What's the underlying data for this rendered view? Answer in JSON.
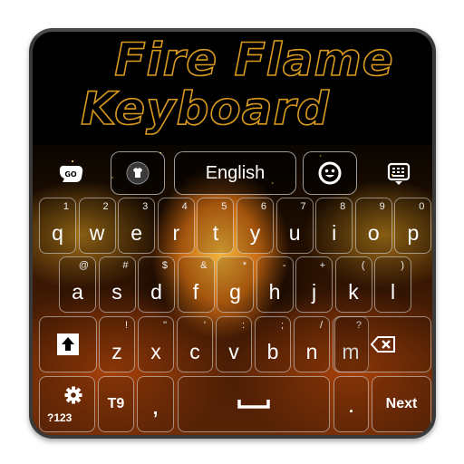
{
  "app": {
    "title_line1": "Fire Flame",
    "title_line2": "Keyboard"
  },
  "toolbar": {
    "go_icon": "go-logo-icon",
    "go_label": "GO",
    "theme_icon": "tshirt-icon",
    "language_label": "English",
    "emoji_icon": "smiley-icon",
    "keyboard_menu_icon": "keyboard-hide-icon"
  },
  "colors": {
    "title_outline": "#d99a1e",
    "key_border": "#e6e6e6",
    "text": "#ffffff"
  },
  "keys": {
    "row1": [
      {
        "main": "q",
        "sub": "1"
      },
      {
        "main": "w",
        "sub": "2"
      },
      {
        "main": "e",
        "sub": "3"
      },
      {
        "main": "r",
        "sub": "4"
      },
      {
        "main": "t",
        "sub": "5"
      },
      {
        "main": "y",
        "sub": "6"
      },
      {
        "main": "u",
        "sub": "7"
      },
      {
        "main": "i",
        "sub": "8"
      },
      {
        "main": "o",
        "sub": "9"
      },
      {
        "main": "p",
        "sub": "0"
      }
    ],
    "row2": [
      {
        "main": "a",
        "sub": "@"
      },
      {
        "main": "s",
        "sub": "#"
      },
      {
        "main": "d",
        "sub": "$"
      },
      {
        "main": "f",
        "sub": "&"
      },
      {
        "main": "g",
        "sub": "*"
      },
      {
        "main": "h",
        "sub": "-"
      },
      {
        "main": "j",
        "sub": "+"
      },
      {
        "main": "k",
        "sub": "("
      },
      {
        "main": "l",
        "sub": ")"
      }
    ],
    "row3": [
      {
        "main": "z",
        "sub": "!"
      },
      {
        "main": "x",
        "sub": "\""
      },
      {
        "main": "c",
        "sub": "'"
      },
      {
        "main": "v",
        "sub": ":"
      },
      {
        "main": "b",
        "sub": ";"
      },
      {
        "main": "n",
        "sub": "/"
      },
      {
        "main": "m",
        "sub": "?"
      }
    ],
    "shift_icon": "shift-arrow-icon",
    "backspace_icon": "backspace-icon",
    "symbols_label": "?123",
    "settings_icon": "gear-icon",
    "t9_label": "T9",
    "comma_label": ",",
    "space_icon": "space-bar-icon",
    "period_label": ".",
    "next_label": "Next"
  }
}
